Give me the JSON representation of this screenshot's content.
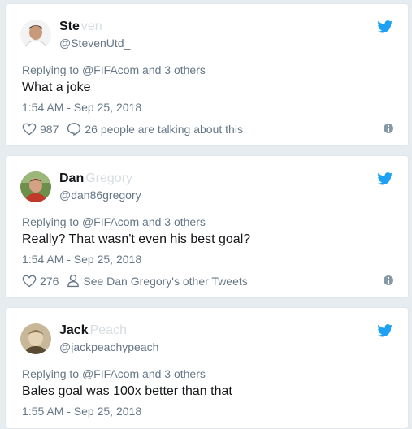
{
  "tweets": [
    {
      "name": "Ste",
      "name_faded": "ven",
      "handle": "@StevenUtd_",
      "reply_prefix": "Replying to",
      "reply_to": "@FIFAcom and 3 others",
      "text": "What a joke",
      "time": "1:54 AM - Sep 25, 2018",
      "likes": "987",
      "second_action": "26 people are talking about this"
    },
    {
      "name": "Dan",
      "name_faded": "Gregory",
      "handle": "@dan86gregory",
      "reply_prefix": "Replying to",
      "reply_to": "@FIFAcom and 3 others",
      "text": "Really? That wasn't even his best goal?",
      "time": "1:54 AM - Sep 25, 2018",
      "likes": "276",
      "second_action": "See Dan Gregory's other Tweets"
    },
    {
      "name": "Jack",
      "name_faded": "Peach",
      "handle": "@jackpeachypeach",
      "reply_prefix": "Replying to",
      "reply_to": "@FIFAcom and 3 others",
      "text": "Bales goal was 100x better than that",
      "time": "1:55 AM - Sep 25, 2018"
    }
  ],
  "colors": {
    "twitter_blue": "#1da1f2",
    "muted": "#657786",
    "background": "#e6ecf0"
  }
}
